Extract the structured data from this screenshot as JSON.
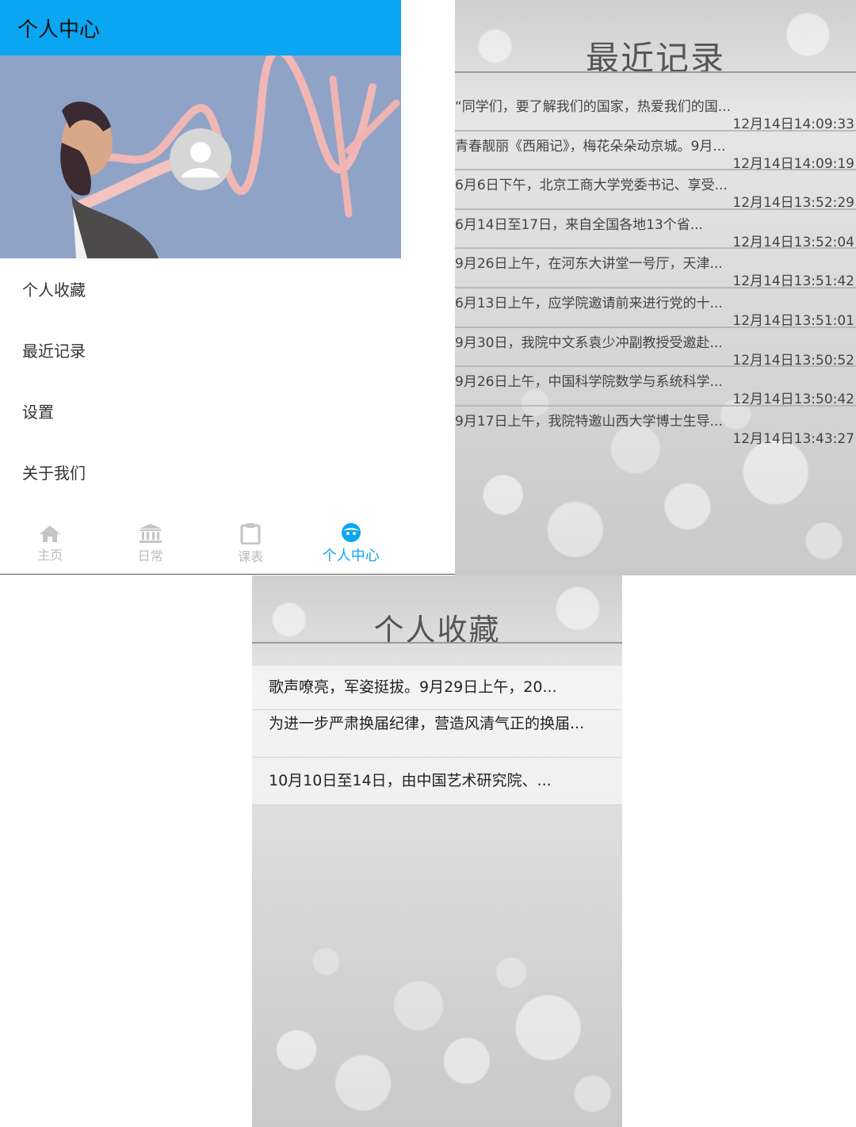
{
  "personal_center": {
    "title": "个人中心",
    "menu": [
      {
        "label": "个人收藏"
      },
      {
        "label": "最近记录"
      },
      {
        "label": "设置"
      },
      {
        "label": "关于我们"
      }
    ],
    "tabs": [
      {
        "label": "主页",
        "icon": "home-icon",
        "active": false
      },
      {
        "label": "日常",
        "icon": "bank-icon",
        "active": false
      },
      {
        "label": "课表",
        "icon": "clipboard-icon",
        "active": false
      },
      {
        "label": "个人中心",
        "icon": "face-icon",
        "active": true
      }
    ],
    "accent_color": "#0aa6f2"
  },
  "recent_records": {
    "title": "最近记录",
    "items": [
      {
        "title": "“同学们，要了解我们的国家，热爱我们的国...",
        "time": "12月14日14:09:33"
      },
      {
        "title": "青春靓丽《西厢记》，梅花朵朵动京城。9月...",
        "time": "12月14日14:09:19"
      },
      {
        "title": "6月6日下午，北京工商大学党委书记、享受...",
        "time": "12月14日13:52:29"
      },
      {
        "title": "6月14日至17日，来自全国各地13个省...",
        "time": "12月14日13:52:04"
      },
      {
        "title": "9月26日上午，在河东大讲堂一号厅，天津...",
        "time": "12月14日13:51:42"
      },
      {
        "title": "6月13日上午，应学院邀请前来进行党的十...",
        "time": "12月14日13:51:01"
      },
      {
        "title": "9月30日，我院中文系袁少冲副教授受邀赴...",
        "time": "12月14日13:50:52"
      },
      {
        "title": "9月26日上午，中国科学院数学与系统科学...",
        "time": "12月14日13:50:42"
      },
      {
        "title": "9月17日上午，我院特邀山西大学博士生导...",
        "time": "12月14日13:43:27"
      }
    ]
  },
  "favorites": {
    "title": "个人收藏",
    "items": [
      {
        "title": "歌声嘹亮，军姿挺拔。9月29日上午，20..."
      },
      {
        "title": "为进一步严肃换届纪律，营造风清气正的换届..."
      },
      {
        "title": "10月10日至14日，由中国艺术研究院、..."
      }
    ]
  }
}
